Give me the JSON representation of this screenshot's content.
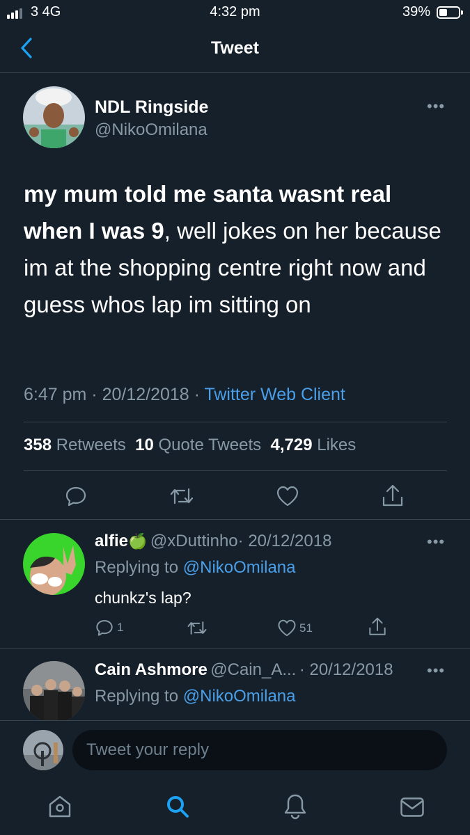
{
  "status_bar": {
    "carrier": "3  4G",
    "time": "4:32 pm",
    "battery": "39%"
  },
  "header": {
    "title": "Tweet",
    "back_icon": "chevron-left-icon"
  },
  "tweet": {
    "author_name": "NDL Ringside",
    "author_handle": "@NikoOmilana",
    "text_bold": "my mum told me santa wasnt real when I was 9",
    "text_rest": ", well jokes on her because im at the shopping centre right now and guess whos lap im sitting on",
    "time": "6:47 pm",
    "sep": "·",
    "date": "20/12/2018",
    "client": "Twitter Web Client",
    "stats": {
      "retweets_count": "358",
      "retweets_label": "Retweets",
      "quotes_count": "10",
      "quotes_label": "Quote Tweets",
      "likes_count": "4,729",
      "likes_label": "Likes"
    },
    "more": "•••"
  },
  "replies": [
    {
      "name": "alfie",
      "emoji": "🍏",
      "handle": "@xDuttinho",
      "date": "· 20/12/2018",
      "replying_prefix": "Replying to",
      "replying_handle": "@NikoOmilana",
      "text": "chunkz's lap?",
      "reply_count": "1",
      "like_count": "51"
    },
    {
      "name": "Cain Ashmore",
      "handle": "@Cain_A...",
      "date": "· 20/12/2018",
      "replying_prefix": "Replying to",
      "replying_handle": "@NikoOmilana"
    }
  ],
  "composer": {
    "placeholder": "Tweet your reply"
  },
  "tab_bar": [
    "home-icon",
    "search-icon",
    "notifications-icon",
    "messages-icon"
  ],
  "colors": {
    "background": "#15202b",
    "accent": "#1da1f2",
    "muted": "#8899a6",
    "divider": "#38444d"
  }
}
